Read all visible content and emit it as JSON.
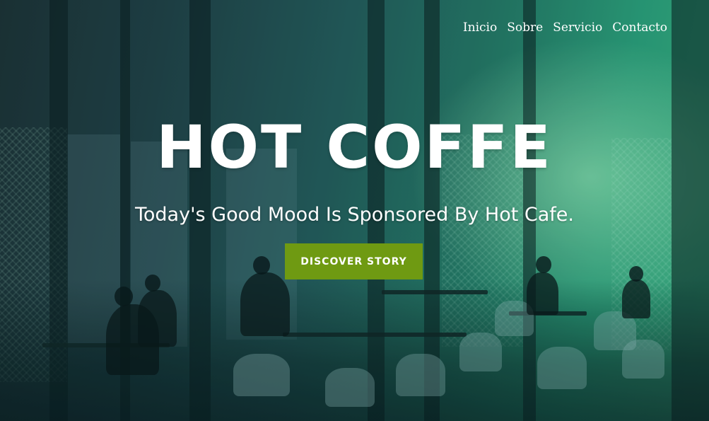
{
  "nav": {
    "items": [
      {
        "label": "Inicio"
      },
      {
        "label": "Sobre"
      },
      {
        "label": "Servicio"
      },
      {
        "label": "Contacto"
      }
    ]
  },
  "hero": {
    "title": "HOT COFFE",
    "subtitle": "Today's Good Mood Is Sponsored By Hot Cafe.",
    "cta_label": "DISCOVER STORY",
    "background_image": "restaurant-interior-photo"
  },
  "colors": {
    "cta_background": "#6f9a12",
    "text": "#ffffff",
    "overlay_start": "#1c2f33",
    "overlay_end": "#3bb383"
  }
}
